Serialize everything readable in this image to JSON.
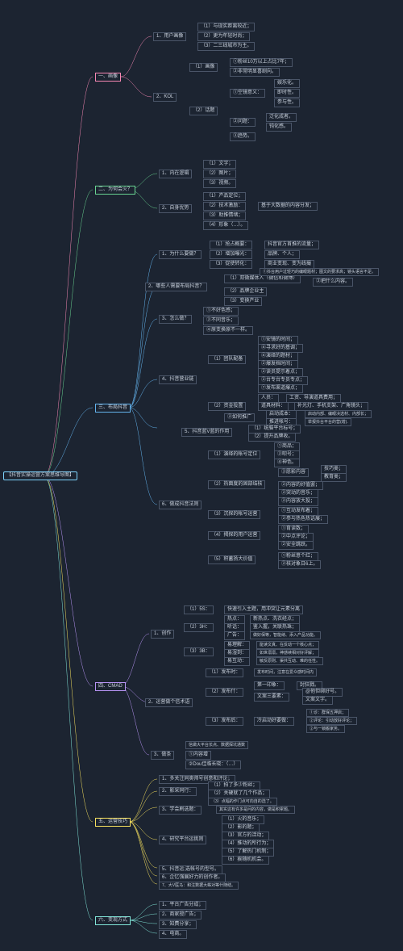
{
  "chart_data": {
    "type": "mindmap",
    "root": "【抖音实操运营方案思维导图】",
    "branches": [
      {
        "title": "一、画像",
        "children": [
          {
            "title": "1、用户画像",
            "children": [
              "（1）与现实距离较近；",
              "（2）更为年轻时尚；",
              "（3）二三线城市为主。"
            ]
          },
          {
            "title": "2、KOL",
            "children": [
              {
                "title": "（1）画像",
                "children": [
                  "①粉丝10万以上占比7年；",
                  "②非常明显喜剧向。"
                ]
              },
              {
                "title": "（2）话题",
                "children": [
                  {
                    "title": "①空镜意义：",
                    "children": [
                      "娱乐化。",
                      "即时性。",
                      "参与性。"
                    ]
                  },
                  {
                    "title": "②问题：",
                    "children": [
                      "泛化成者。",
                      "钝化感。",
                      "②趋势。"
                    ]
                  }
                ]
              }
            ]
          }
        ]
      },
      {
        "title": "二、为何会火？",
        "children": [
          {
            "title": "1、内在逻辑",
            "children": [
              "（1）文字；",
              "（2）图片；",
              "（3）视频。"
            ]
          },
          {
            "title": "2、自身优势",
            "children": [
              "（1）产品定位；",
              {
                "title": "（2）技术激励：",
                "children": [
                  "基于大数据的内容分发；"
                ]
              },
              "（3）助推情绪；",
              "（4）形象（…）。"
            ]
          }
        ]
      },
      {
        "title": "三、布局抖音",
        "children": [
          {
            "title": "1、为什么要做？",
            "children": [
              {
                "title": "（1）抢占概要：",
                "children": [
                  "抖音官方首推的流量；"
                ]
              },
              {
                "title": "（2）增加曝光：",
                "children": [
                  "品牌、个人；"
                ]
              },
              {
                "title": "（3）促使转化：",
                "children": [
                  "商业变现、变为线撮"
                ]
              }
            ]
          },
          {
            "title": "2、哪些人需要布局抖音？",
            "children": [
              {
                "title": "（1）双微媒体人（微信和微博）",
                "children": [
                  "①抖台用户过轻巧的编眼睛材；图文的要求能高；镜头语言不足。",
                  "②把什么内容。"
                ]
              },
              "（2）品牌企业主",
              "（3）变换产业"
            ]
          },
          {
            "title": "3、怎么做？",
            "children": [
              "①不好色感；",
              "②不同音乐；",
              "④原变换原不一样。"
            ]
          },
          {
            "title": "4、抖音营业链",
            "children": [
              {
                "title": "（1）团队配备",
                "children": [
                  "①安镜的时间；",
                  "④寻求好的基调；",
                  "④演绎的题材；",
                  "②爆发档时间；",
                  "②读员提示着点；",
                  "②台专台专员专点；",
                  "⑦发布渠道爆点；"
                ]
              },
              {
                "title": "（2）资金投置",
                "children": [
                  {
                    "title": "人员：",
                    "children": [
                      "工资、导演道具费用；"
                    ]
                  },
                  {
                    "title": "道具材料：",
                    "children": [
                      "补光灯、手机支架、广角镜头；"
                    ]
                  },
                  {
                    "title": "②如何推广",
                    "children": [
                      {
                        "title": "启动成本：",
                        "children": [
                          "启动内部、编眼决选材、内部长；"
                        ]
                      },
                      {
                        "title": "推进帐号：",
                        "children": [
                          "举报抖台平台的营(增)."
                        ]
                      }
                    ]
                  }
                ]
              },
              {
                "title": "5、抖音蓝V蓝的作用",
                "children": [
                  "（1）统脑平台标号；",
                  "（2）提升品牌收。"
                ]
              }
            ]
          },
          {
            "title": "6、做成抖音法则",
            "children": [
              {
                "title": "（1）演绎的帐号定位",
                "children": [
                  "①商品；",
                  "②呗号；",
                  "④神色。"
                ]
              },
              {
                "title": "（2）热面度的固部结核",
                "children": [
                  {
                    "title": "③愿影内容",
                    "children": [
                      "技巧类；",
                      "教育类；"
                    ]
                  },
                  "②内容的好值罢；",
                  "②突动的音乐；",
                  "②内容放大投；"
                ]
              },
              {
                "title": "（3）沉探的帐号运营",
                "children": [
                  "①互动发布着；",
                  "②参与热色热话展；"
                ]
              },
              {
                "title": "（4）揭探的用户运营",
                "children": [
                  "①育读数；",
                  "②中点评论；",
                  "②安全跳跃。"
                ]
              },
              {
                "title": "（5）积蓄扬大价值",
                "children": [
                  "①粉丝意个红；",
                  "②核对象日6上。"
                ]
              }
            ]
          }
        ]
      },
      {
        "title": "四、CMAD",
        "children": [
          {
            "title": "1、创作",
            "children": [
              {
                "title": "（1）5S：",
                "children": [
                  "快速引入主题，用冲突让元素分离"
                ]
              },
              {
                "title": "（2）3H：",
                "children": [
                  {
                    "title": "热点：",
                    "children": [
                      "新热点、洗衣经点；"
                    ]
                  },
                  {
                    "title": "听话：",
                    "children": [
                      "鉴入握，关联热珠；"
                    ]
                  },
                  {
                    "title": "广告：",
                    "children": [
                      "做好保等，智能纳、添入产品功能。"
                    ]
                  }
                ]
              },
              {
                "title": "（3）3B：",
                "children": [
                  {
                    "title": "易理解：",
                    "children": [
                      "能读文真、在反动一个核心点；"
                    ]
                  },
                  {
                    "title": "易湿到：",
                    "children": [
                      "如世溺溺，神感续相对好评解；"
                    ]
                  },
                  {
                    "title": "易互动：",
                    "children": [
                      "敏反原则、渠共互动、难的任性。"
                    ]
                  }
                ]
              }
            ]
          },
          {
            "title": "2、运营做个信术语",
            "children": [
              {
                "title": "（1）发布时：",
                "children": [
                  "发布时间，注意在爱众感时间内"
                ]
              },
              {
                "title": "（2）发布什：",
                "children": [
                  {
                    "title": "第一印象：",
                    "children": [
                      "封狂戮。"
                    ]
                  },
                  {
                    "title": "文案三要素：",
                    "children": [
                      "@他但绑好号。",
                      "文案文字。"
                    ]
                  }
                ]
              },
              {
                "title": "（3）发布后：",
                "children": [
                  {
                    "title": "冷启动好要做：",
                    "children": [
                      "①诊：群保五押启；",
                      "②评论：引动放好评论；",
                      "②与一锁搬家务。"
                    ]
                  }
                ]
              }
            ]
          },
          {
            "title": "3、做条",
            "children": [
              "信做大平台长点、数据探坑通数",
              "①内容增",
              "②Dou佳临长晓：（…）"
            ]
          }
        ]
      },
      {
        "title": "五、运营技巧",
        "children": [
          "1、多关注同奥帅号创意和评论；",
          {
            "title": "2、影采同行：",
            "children": [
              "（1）拍了多少粉丝；",
              "（2）关硬就了几个作品；",
              "（3）点幅的作门点可向自的选了。"
            ]
          },
          {
            "title": "3、学会刷选题：",
            "children": [
              "其实这有许多是问的内容，做是积累题。"
            ]
          },
          {
            "title": "4、研究平台运挑则",
            "children": [
              "（1）火的音乐；",
              "（2）影的题；",
              "（3）官方的活动；",
              "（4）推动的所行为；",
              "（5）了解热门机制；",
              "（6）挨随机机会。"
            ]
          },
          "5、抖音运;选帐号的型号。",
          "6、企忆强展好力的创作者。",
          "7、大V医马：和注数据大蛛对等什随结。"
        ]
      },
      {
        "title": "六、变现方式",
        "children": [
          "1、平台广告分成；",
          "2、商家授广告；",
          "3、知费分享；",
          "4、电商。"
        ]
      }
    ]
  },
  "root_label": "【抖音实操运营方案思维导图】",
  "b1": "一、画像",
  "b1_1": "1、用户画像",
  "b1_1_1": "（1）与现实距离较近；",
  "b1_1_2": "（2）更为年轻时尚；",
  "b1_1_3": "（3）二三线城市为主。",
  "b1_2": "2、KOL",
  "b1_2_1": "（1）画像",
  "b1_2_1_1": "①粉丝10万以上占比7年；",
  "b1_2_1_2": "②非常明显喜剧向。",
  "b1_2_2": "（2）话题",
  "b1_2_2_1": "①空镜意义：",
  "b1_2_2_1_1": "娱乐化。",
  "b1_2_2_1_2": "即时性。",
  "b1_2_2_1_3": "参与性。",
  "b1_2_2_2": "②问题：",
  "b1_2_2_2_1": "泛化成者。",
  "b1_2_2_2_2": "钝化感。",
  "b1_2_2_3": "②趋势。",
  "b2": "二、为何会火？",
  "b2_1": "1、内在逻辑",
  "b2_1_1": "（1）文字；",
  "b2_1_2": "（2）图片；",
  "b2_1_3": "（3）视频。",
  "b2_2": "2、自身优势",
  "b2_2_1": "（1）产品定位；",
  "b2_2_2": "（2）技术激励：",
  "b2_2_2_1": "基于大数据的内容分发；",
  "b2_2_3": "（3）助推情绪；",
  "b2_2_4": "（4）形象（…）。",
  "b3": "三、布局抖音",
  "b3_1": "1、为什么要做？",
  "b3_1_1": "（1）抢占概要：",
  "b3_1_1v": "抖音官方首推的流量；",
  "b3_1_2": "（2）增加曝光：",
  "b3_1_2v": "品牌、个人；",
  "b3_1_3": "（3）促使转化：",
  "b3_1_3v": "商业变现、变为线撮",
  "b3_2": "2、哪些人需要布局抖音？",
  "b3_2_1": "（1）双微媒体人（微信和微博）",
  "b3_2_1a": "①抖台用户过轻巧的编眼题材；图文的要求高；镜头语言不足。",
  "b3_2_1b": "②把什么内容。",
  "b3_2_2": "（2）品牌企业主",
  "b3_2_3": "（3）变换产业",
  "b3_3": "3、怎么做？",
  "b3_3_1": "①不好色感；",
  "b3_3_2": "②不同音乐；",
  "b3_3_3": "④原变换原不一样。",
  "b3_4": "4、抖音营业链",
  "b3_4_1": "（1）团队配备",
  "b3_4_1a": "①安镜的时间；",
  "b3_4_1b": "④寻求好的基调；",
  "b3_4_1c": "④演绎的题材；",
  "b3_4_1d": "②爆发档时间；",
  "b3_4_1e": "②读员提示着点；",
  "b3_4_1f": "②台专台专员专点；",
  "b3_4_1g": "⑦发布渠道爆点；",
  "b3_4_2": "（2）资金投置",
  "b3_4_2a": "人员：",
  "b3_4_2a_v": "工资、导演道具费用；",
  "b3_4_2b": "道具材料：",
  "b3_4_2b_v": "补光灯、手机支架、广角镜头；",
  "b3_4_2c": "②如何推广",
  "b3_4_2c1": "启动成本：",
  "b3_4_2c1v": "启动内部、编眼决选材、内部长；",
  "b3_4_2c2": "推进帐号：",
  "b3_4_2c2v": "举报抖台平台的营(增).",
  "b3_5": "5、抖音蓝V蓝的作用",
  "b3_5_1": "（1）统脑平台标号；",
  "b3_5_2": "（2）提升品牌收。",
  "b3_6": "6、做成抖音法则",
  "b3_6_1": "（1）演绎的帐号定位",
  "b3_6_1a": "①商品；",
  "b3_6_1b": "②呗号；",
  "b3_6_1c": "④神色。",
  "b3_6_2": "（2）热面度的固部结核",
  "b3_6_2a": "③愿影内容",
  "b3_6_2a1": "技巧类；",
  "b3_6_2a2": "教育类；",
  "b3_6_2b": "②内容的好值罢；",
  "b3_6_2c": "②突动的音乐；",
  "b3_6_2d": "②内容放大投；",
  "b3_6_3": "（3）沉探的帐号运营",
  "b3_6_3a": "①互动发布着；",
  "b3_6_3b": "②参与热色热话展；",
  "b3_6_4": "（4）揭探的用户运营",
  "b3_6_4a": "①育读数；",
  "b3_6_4b": "②中点评论；",
  "b3_6_4c": "②安全跳跃。",
  "b3_6_5": "（5）积蓄扬大价值",
  "b3_6_5a": "①粉丝意个红；",
  "b3_6_5b": "②核对象日6上。",
  "b4": "四、CMAD",
  "b4_1": "1、创作",
  "b4_1_1": "（1）5S：",
  "b4_1_1v": "快速引入主题，用冲突让元素分离",
  "b4_1_2": "（2）3H：",
  "b4_1_2a": "热点：",
  "b4_1_2av": "新热点、洗衣经点；",
  "b4_1_2b": "听话：",
  "b4_1_2bv": "鉴入握，关联热珠；",
  "b4_1_2c": "广告：",
  "b4_1_2cv": "做好保等，智能纳、添入产品功能。",
  "b4_1_3": "（3）3B：",
  "b4_1_3a": "易理解：",
  "b4_1_3av": "能读文真、在反动一个核心点；",
  "b4_1_3b": "易湿到：",
  "b4_1_3bv": "如世溺溺，神感续相对好评解；",
  "b4_1_3c": "易互动：",
  "b4_1_3cv": "敏反原则、渠共互动、难的任性。",
  "b4_2": "2、运营做个信术语",
  "b4_2_1": "（1）发布时：",
  "b4_2_1v": "发布时间，注意在爱众感时间内",
  "b4_2_2": "（2）发布什：",
  "b4_2_2a": "第一印象：",
  "b4_2_2av": "封狂戮。",
  "b4_2_2b": "文案三要素：",
  "b4_2_2bv1": "@他但绑好号。",
  "b4_2_2bv2": "文案文字。",
  "b4_2_3": "（3）发布后：",
  "b4_2_3a": "冷启动好要做：",
  "b4_2_3av1": "①诊：群保五押启；",
  "b4_2_3av2": "②评论：引动放好评论；",
  "b4_2_3av3": "②与一锁搬家务。",
  "b4_3": "3、做条",
  "b4_3_1": "信做大平台长点、数据探坑通数",
  "b4_3_2": "①内容增",
  "b4_3_3": "②Dou佳临长晓：（…）",
  "b5": "五、运营技巧",
  "b5_1": "1、多关注同奥帅号创意和评论；",
  "b5_2": "2、影采同行：",
  "b5_2_1": "（1）拍了多少粉丝；",
  "b5_2_2": "（2）关硬就了几个作品；",
  "b5_2_3": "（3）点幅的作门点可向自的选了。",
  "b5_3": "3、学会刷选题：",
  "b5_3v": "其实这有许多是问的内容，做是积累题。",
  "b5_4": "4、研究平台运挑则",
  "b5_4_1": "（1）火的音乐；",
  "b5_4_2": "（2）影的题；",
  "b5_4_3": "（3）官方的活动；",
  "b5_4_4": "（4）推动的所行为；",
  "b5_4_5": "（5）了解热门机制；",
  "b5_4_6": "（6）挨随机机会。",
  "b5_5": "5、抖音运;选帐号的型号。",
  "b5_6": "6、企忆强展好力的创作者。",
  "b5_7": "7、大V医马：和注数据大蛛对等什随结。",
  "b6": "六、变现方式",
  "b6_1": "1、平台广告分成；",
  "b6_2": "2、商家授广告；",
  "b6_3": "3、知费分享；",
  "b6_4": "4、电商。"
}
